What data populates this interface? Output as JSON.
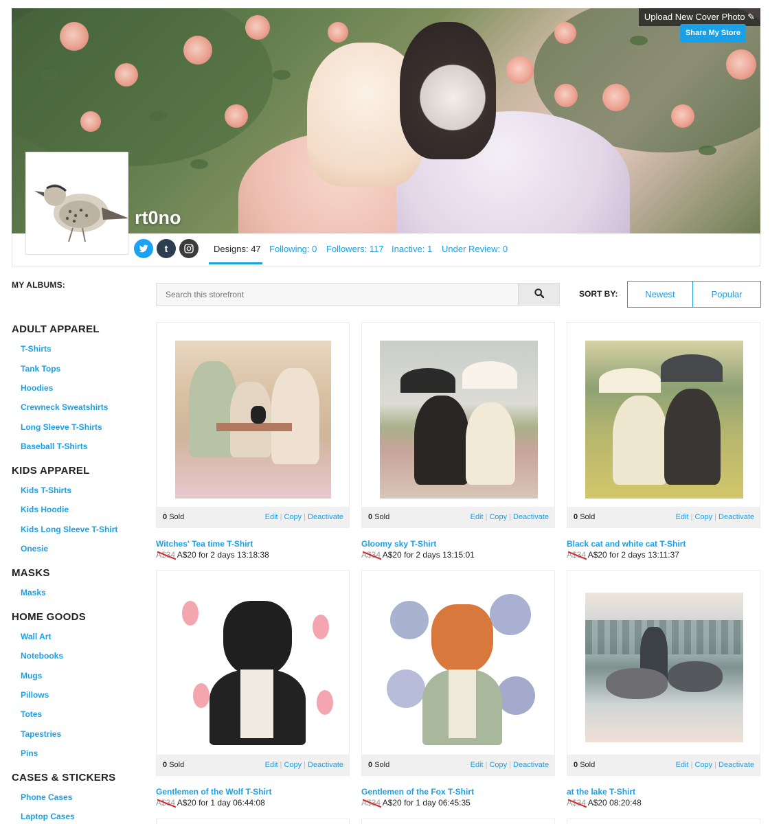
{
  "cover": {
    "upload_label": "Upload New Cover Photo ✎",
    "share_label": "Share My Store"
  },
  "store": {
    "name": "rt0no"
  },
  "social": {
    "twitter": "t-bird",
    "tumblr": "t",
    "instagram": "ig"
  },
  "stats": [
    {
      "label": "Designs: 47"
    },
    {
      "label": "Following: 0"
    },
    {
      "label": "Followers: 117"
    },
    {
      "label": "Inactive: 1"
    },
    {
      "label": "Under Review: 0"
    }
  ],
  "sidebar": {
    "title": "MY ALBUMS:",
    "sections": [
      {
        "heading": "ADULT APPAREL",
        "items": [
          "T-Shirts",
          "Tank Tops",
          "Hoodies",
          "Crewneck Sweatshirts",
          "Long Sleeve T-Shirts",
          "Baseball T-Shirts"
        ]
      },
      {
        "heading": "KIDS APPAREL",
        "items": [
          "Kids T-Shirts",
          "Kids Hoodie",
          "Kids Long Sleeve T-Shirt",
          "Onesie"
        ]
      },
      {
        "heading": "MASKS",
        "items": [
          "Masks"
        ]
      },
      {
        "heading": "HOME GOODS",
        "items": [
          "Wall Art",
          "Notebooks",
          "Mugs",
          "Pillows",
          "Totes",
          "Tapestries",
          "Pins"
        ]
      },
      {
        "heading": "CASES & STICKERS",
        "items": [
          "Phone Cases",
          "Laptop Cases"
        ]
      }
    ]
  },
  "search": {
    "placeholder": "Search this storefront"
  },
  "sort": {
    "label": "SORT BY:",
    "options": [
      "Newest",
      "Popular"
    ]
  },
  "products": [
    {
      "sold": "0",
      "sold_label": "Sold",
      "title": "Witches' Tea time T-Shirt",
      "old_price": "A$34",
      "new_price": "A$20 for 2 days 13:18:38"
    },
    {
      "sold": "0",
      "sold_label": "Sold",
      "title": "Gloomy sky T-Shirt",
      "old_price": "A$34",
      "new_price": "A$20 for 2 days 13:15:01"
    },
    {
      "sold": "0",
      "sold_label": "Sold",
      "title": "Black cat and white cat T-Shirt",
      "old_price": "A$34",
      "new_price": "A$20 for 2 days 13:11:37"
    },
    {
      "sold": "0",
      "sold_label": "Sold",
      "title": "Gentlemen of the Wolf T-Shirt",
      "old_price": "A$34",
      "new_price": "A$20 for 1 day 06:44:08"
    },
    {
      "sold": "0",
      "sold_label": "Sold",
      "title": "Gentlemen of the Fox T-Shirt",
      "old_price": "A$34",
      "new_price": "A$20 for 1 day 06:45:35"
    },
    {
      "sold": "0",
      "sold_label": "Sold",
      "title": "at the lake T-Shirt",
      "old_price": "A$34",
      "new_price": "A$20 08:20:48"
    }
  ],
  "actions": {
    "edit": "Edit",
    "copy": "Copy",
    "deactivate": "Deactivate"
  },
  "colors": {
    "accent": "#1aa0e6",
    "sale_strike": "#d6262a"
  }
}
